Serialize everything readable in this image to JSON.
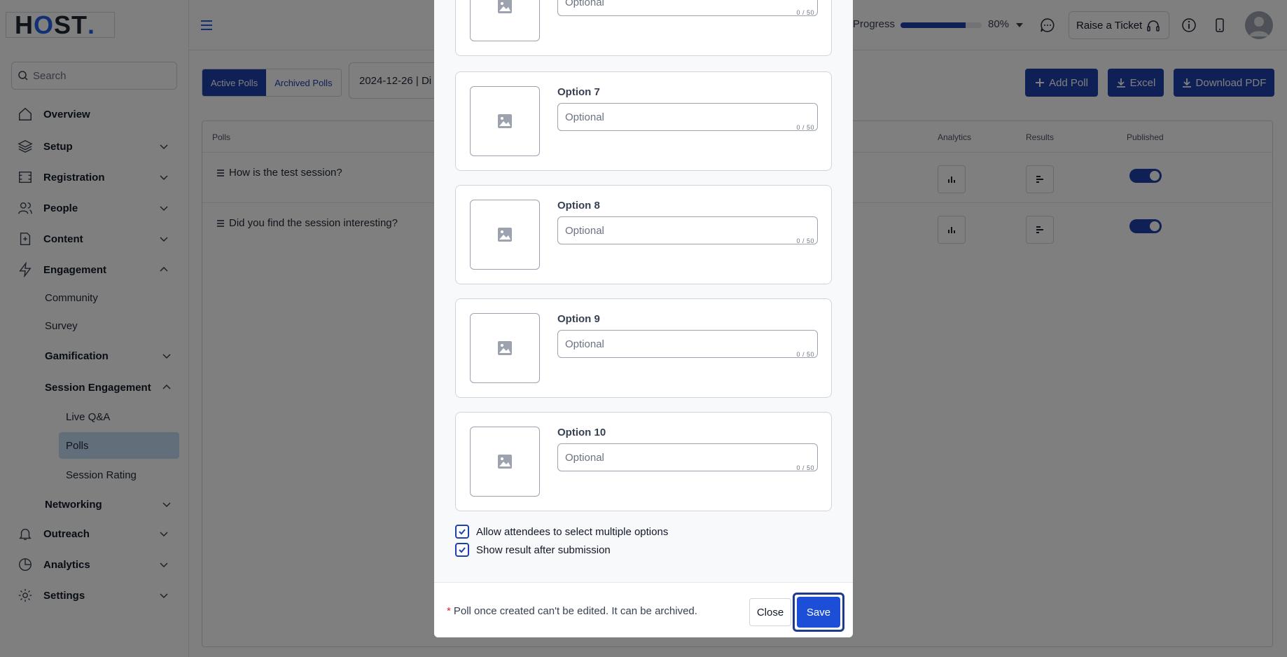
{
  "logo": {
    "text_h": "H",
    "text_o": "O",
    "text_st": "ST",
    "text_dot": "."
  },
  "search": {
    "placeholder": "Search"
  },
  "sidebar": {
    "items": [
      {
        "label": "Overview"
      },
      {
        "label": "Setup"
      },
      {
        "label": "Registration"
      },
      {
        "label": "People"
      },
      {
        "label": "Content"
      },
      {
        "label": "Engagement"
      },
      {
        "label": "Networking"
      },
      {
        "label": "Outreach"
      },
      {
        "label": "Analytics"
      },
      {
        "label": "Settings"
      }
    ],
    "engagement_sub": [
      {
        "label": "Community"
      },
      {
        "label": "Survey"
      },
      {
        "label": "Gamification"
      },
      {
        "label": "Session Engagement"
      }
    ],
    "session_sub": [
      {
        "label": "Live Q&A"
      },
      {
        "label": "Polls"
      },
      {
        "label": "Session Rating"
      }
    ]
  },
  "header": {
    "progress_label": "Progress",
    "progress_value": 80,
    "progress_text": "80%",
    "ticket_label": "Raise a Ticket"
  },
  "main": {
    "tabs": [
      {
        "label": "Active Polls"
      },
      {
        "label": "Archived Polls"
      }
    ],
    "date_filter": "2024-12-26 | Di",
    "buttons": {
      "add_poll": "Add Poll",
      "excel": "Excel",
      "download_pdf": "Download PDF"
    },
    "table": {
      "columns": {
        "polls": "Polls",
        "analytics": "Analytics",
        "results": "Results",
        "published": "Published"
      },
      "rows": [
        {
          "question": "How is the test session?",
          "published": true
        },
        {
          "question": "Did you find the session interesting?",
          "published": true
        }
      ]
    }
  },
  "modal": {
    "options": [
      {
        "label": "",
        "placeholder": "Optional",
        "count": "0 / 50"
      },
      {
        "label": "Option 7",
        "placeholder": "Optional",
        "count": "0 / 50"
      },
      {
        "label": "Option 8",
        "placeholder": "Optional",
        "count": "0 / 50"
      },
      {
        "label": "Option 9",
        "placeholder": "Optional",
        "count": "0 / 50"
      },
      {
        "label": "Option 10",
        "placeholder": "Optional",
        "count": "0 / 50"
      }
    ],
    "checkboxes": [
      {
        "label": "Allow attendees to select multiple options",
        "checked": true
      },
      {
        "label": "Show result after submission",
        "checked": true
      }
    ],
    "footer": {
      "required_mark": "*",
      "note": "Poll once created can't be edited. It can be archived.",
      "close_label": "Close",
      "save_label": "Save"
    }
  },
  "colors": {
    "primary": "#1e40af",
    "accent": "#2563eb",
    "active_nav": "#c7dcf7",
    "danger": "#dc2626"
  }
}
